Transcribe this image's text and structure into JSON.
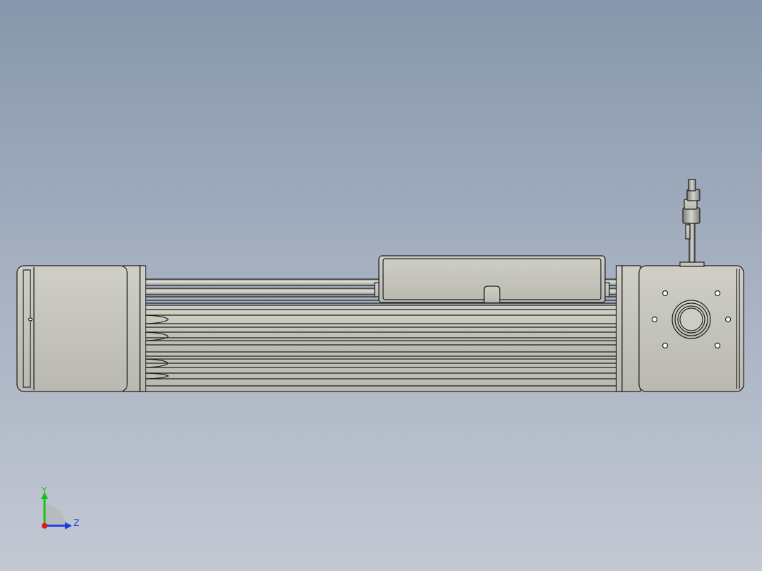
{
  "viewport": {
    "background_top": "#8797ab",
    "background_bottom": "#c3c8d3"
  },
  "model": {
    "part_fill": "#c8c8bf",
    "part_shadow": "#a9a9a1",
    "edge_color": "#1e1e1e"
  },
  "triad": {
    "y_label": "Y",
    "z_label": "Z",
    "y_color": "#18c018",
    "z_color": "#1e3ee0",
    "x_color": "#e01818"
  }
}
